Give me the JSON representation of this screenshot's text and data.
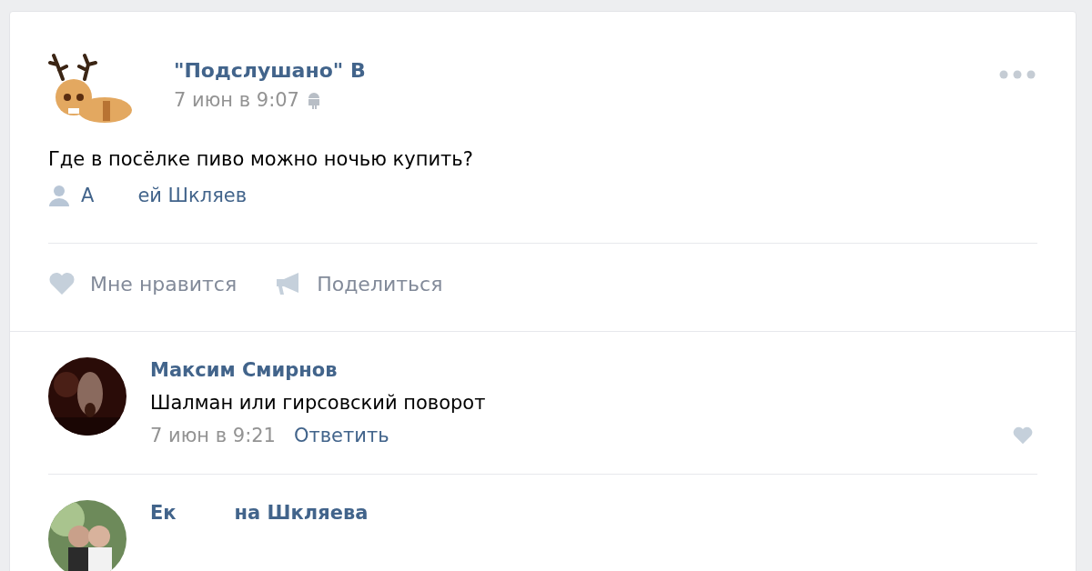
{
  "post": {
    "author": "\"Подслушано\" В",
    "date": "7 июн в 9:07",
    "text": "Где в посёлке пиво можно ночью купить?",
    "signer": [
      "А",
      "ей Шкляев"
    ],
    "actions": [
      {
        "kind": "like",
        "label": "Мне нравится"
      },
      {
        "kind": "share",
        "label": "Поделиться"
      }
    ]
  },
  "comments": [
    {
      "name": [
        "Максим Смирнов"
      ],
      "text": "Шалман или гирсовский поворот",
      "date": "7 июн в 9:21",
      "reply": "Ответить"
    },
    {
      "name": [
        "Ек",
        "на Шкляева"
      ]
    }
  ]
}
